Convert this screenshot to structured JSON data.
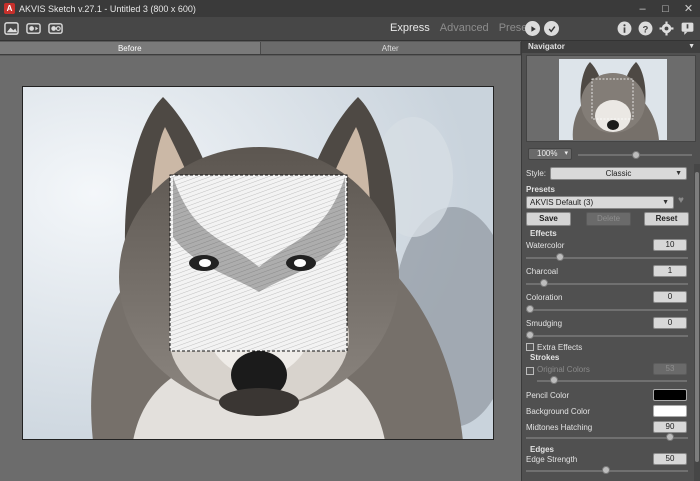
{
  "window": {
    "title": "AKVIS Sketch v.27.1 - Untitled 3 (800 x 600)",
    "controls": [
      "–",
      "□",
      "✕"
    ]
  },
  "toolbar": {
    "left_icons": [
      "open-image-icon",
      "before-after-icon",
      "settings-group-icon"
    ],
    "modes": [
      "Express",
      "Advanced",
      "Presets"
    ],
    "active_mode": "Express",
    "right_icons": [
      "info-icon",
      "help-icon",
      "gear-icon",
      "notification-icon"
    ]
  },
  "view_tabs": {
    "before": "Before",
    "after": "After",
    "active": "Before"
  },
  "navigator": {
    "title": "Navigator",
    "zoom": "100%",
    "zoom_arrow": "▾"
  },
  "settings": {
    "style_label": "Style:",
    "style_value": "Classic",
    "presets_label": "Presets",
    "preset_value": "AKVIS Default (3)",
    "save": "Save",
    "delete": "Delete",
    "reset": "Reset",
    "effects_label": "Effects",
    "watercolor_label": "Watercolor",
    "watercolor_value": "10",
    "charcoal_label": "Charcoal",
    "charcoal_value": "1",
    "coloration_label": "Coloration",
    "coloration_value": "0",
    "smudging_label": "Smudging",
    "smudging_value": "0",
    "extra_effects_label": "Extra Effects",
    "strokes_label": "Strokes",
    "original_colors_label": "Original Colors",
    "original_colors_value": "53",
    "pencil_color_label": "Pencil Color",
    "pencil_color": "#000000",
    "background_color_label": "Background Color",
    "background_color": "#ffffff",
    "midtones_label": "Midtones Hatching",
    "midtones_value": "90",
    "edges_label": "Edges",
    "edge_strength_label": "Edge Strength",
    "edge_strength_value": "50"
  },
  "colors": {
    "accent_red": "#c7302b",
    "panel_bg": "#505050",
    "canvas_bg": "#6c6c6c"
  }
}
